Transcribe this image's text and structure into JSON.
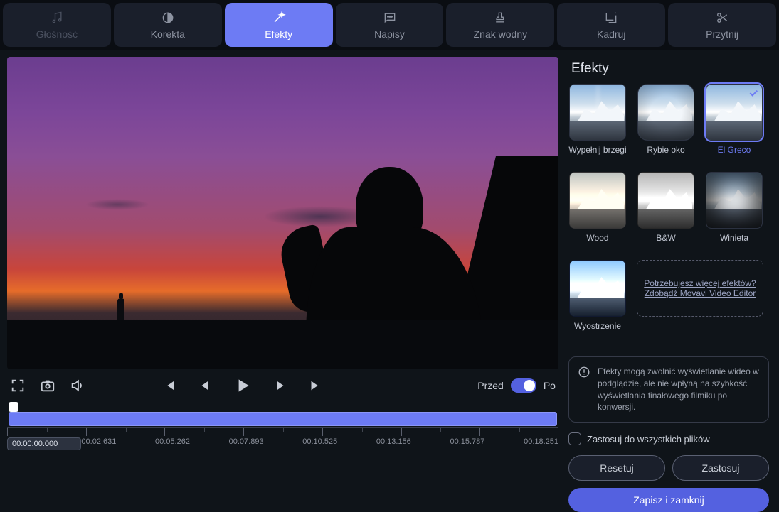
{
  "tabs": [
    {
      "label": "Głośność",
      "icon": "music",
      "state": "disabled"
    },
    {
      "label": "Korekta",
      "icon": "contrast",
      "state": "normal"
    },
    {
      "label": "Efekty",
      "icon": "wand",
      "state": "active"
    },
    {
      "label": "Napisy",
      "icon": "subtitles",
      "state": "normal"
    },
    {
      "label": "Znak wodny",
      "icon": "stamp",
      "state": "normal"
    },
    {
      "label": "Kadruj",
      "icon": "crop-rotate",
      "state": "normal"
    },
    {
      "label": "Przytnij",
      "icon": "scissors",
      "state": "normal"
    }
  ],
  "compare": {
    "before": "Przed",
    "after": "Po",
    "on_after": true
  },
  "timeline": {
    "current": "00:00:00.000",
    "marks": [
      "00:02.631",
      "00:05.262",
      "00:07.893",
      "00:10.525",
      "00:13.156",
      "00:15.787",
      "00:18.251"
    ]
  },
  "panel": {
    "title": "Efekty",
    "effects": [
      {
        "label": "Wypełnij brzegi",
        "kind": "fill split",
        "selected": false
      },
      {
        "label": "Rybie oko",
        "kind": "fish",
        "selected": false
      },
      {
        "label": "El Greco",
        "kind": "",
        "selected": true
      },
      {
        "label": "Wood",
        "kind": "wood",
        "selected": false
      },
      {
        "label": "B&W",
        "kind": "bw",
        "selected": false
      },
      {
        "label": "Winieta",
        "kind": "vig",
        "selected": false
      },
      {
        "label": "Wyostrzenie",
        "kind": "sharp",
        "selected": false
      }
    ],
    "promo_line1": "Potrzebujesz więcej efektów?",
    "promo_line2": "Zdobądź Movavi Video Editor",
    "note": "Efekty mogą zwolnić wyświetlanie wideo w podglądzie, ale nie wpłyną na szybkość wyświetlania finałowego filmiku po konwersji.",
    "apply_all": "Zastosuj do wszystkich plików",
    "reset": "Resetuj",
    "apply": "Zastosuj",
    "save_close": "Zapisz i zamknij"
  }
}
